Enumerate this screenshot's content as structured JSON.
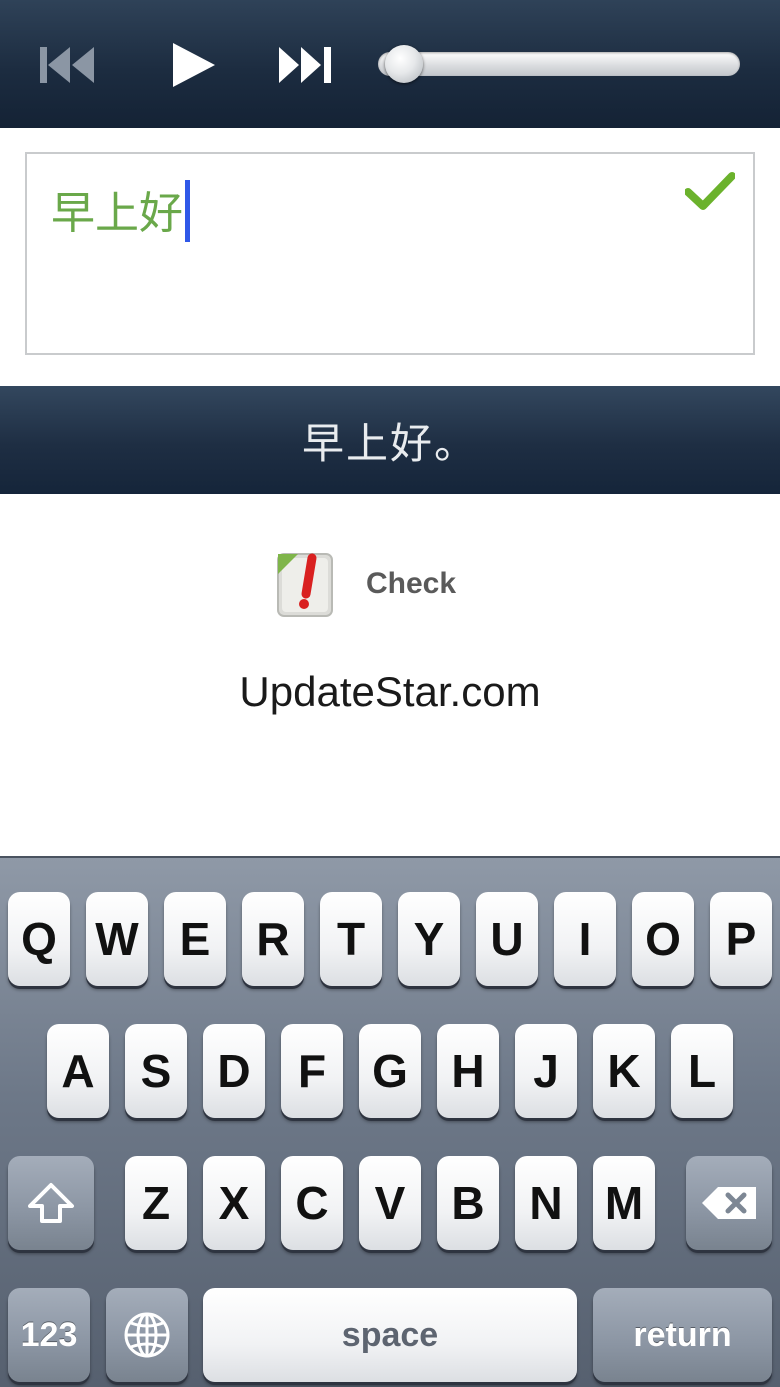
{
  "player": {
    "prev_icon": "skip-previous-icon",
    "play_icon": "play-icon",
    "next_icon": "skip-next-icon",
    "progress": 0.04
  },
  "answer": {
    "value": "早上好",
    "status_icon": "checkmark-icon",
    "status_color": "#6bb22c",
    "text_color": "#6aa84a",
    "caret_color": "#2f58e8"
  },
  "sentence": {
    "text": "早上好。"
  },
  "check": {
    "icon": "document-exclamation-icon",
    "label": "Check"
  },
  "watermark": "UpdateStar.com",
  "keyboard": {
    "row1": [
      "Q",
      "W",
      "E",
      "R",
      "T",
      "Y",
      "U",
      "I",
      "O",
      "P"
    ],
    "row2": [
      "A",
      "S",
      "D",
      "F",
      "G",
      "H",
      "J",
      "K",
      "L"
    ],
    "row3": [
      "Z",
      "X",
      "C",
      "V",
      "B",
      "N",
      "M"
    ],
    "shift_icon": "shift-arrow-icon",
    "backspace_icon": "backspace-icon",
    "numbers_label": "123",
    "globe_icon": "globe-icon",
    "space_label": "space",
    "return_label": "return"
  }
}
